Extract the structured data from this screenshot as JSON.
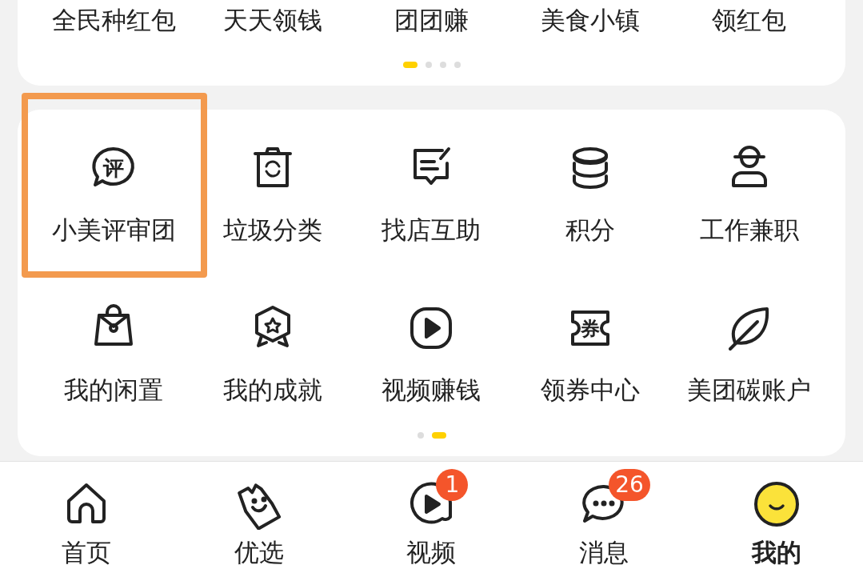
{
  "top_menu": {
    "items": [
      {
        "label": "全民种红包"
      },
      {
        "label": "天天领钱"
      },
      {
        "label": "团团赚"
      },
      {
        "label": "美食小镇"
      },
      {
        "label": "领红包"
      }
    ],
    "pager": [
      {
        "selected": true
      },
      {
        "selected": false
      },
      {
        "selected": false
      },
      {
        "selected": false
      }
    ]
  },
  "services": {
    "items": [
      {
        "label": "小美评审团",
        "icon_text": "评",
        "highlighted": true
      },
      {
        "label": "垃圾分类",
        "highlighted": false
      },
      {
        "label": "找店互助",
        "highlighted": false
      },
      {
        "label": "积分",
        "highlighted": false
      },
      {
        "label": "工作兼职",
        "highlighted": false
      },
      {
        "label": "我的闲置",
        "highlighted": false
      },
      {
        "label": "我的成就",
        "highlighted": false
      },
      {
        "label": "视频赚钱",
        "highlighted": false
      },
      {
        "label": "领券中心",
        "icon_text": "券",
        "highlighted": false
      },
      {
        "label": "美团碳账户",
        "highlighted": false
      }
    ],
    "pager": [
      {
        "selected": false
      },
      {
        "selected": true
      }
    ]
  },
  "tab_bar": [
    {
      "label": "首页",
      "selected": false
    },
    {
      "label": "优选",
      "selected": false
    },
    {
      "label": "视频",
      "badge": "1",
      "selected": false
    },
    {
      "label": "消息",
      "badge": "26",
      "selected": false
    },
    {
      "label": "我的",
      "selected": true
    }
  ]
}
